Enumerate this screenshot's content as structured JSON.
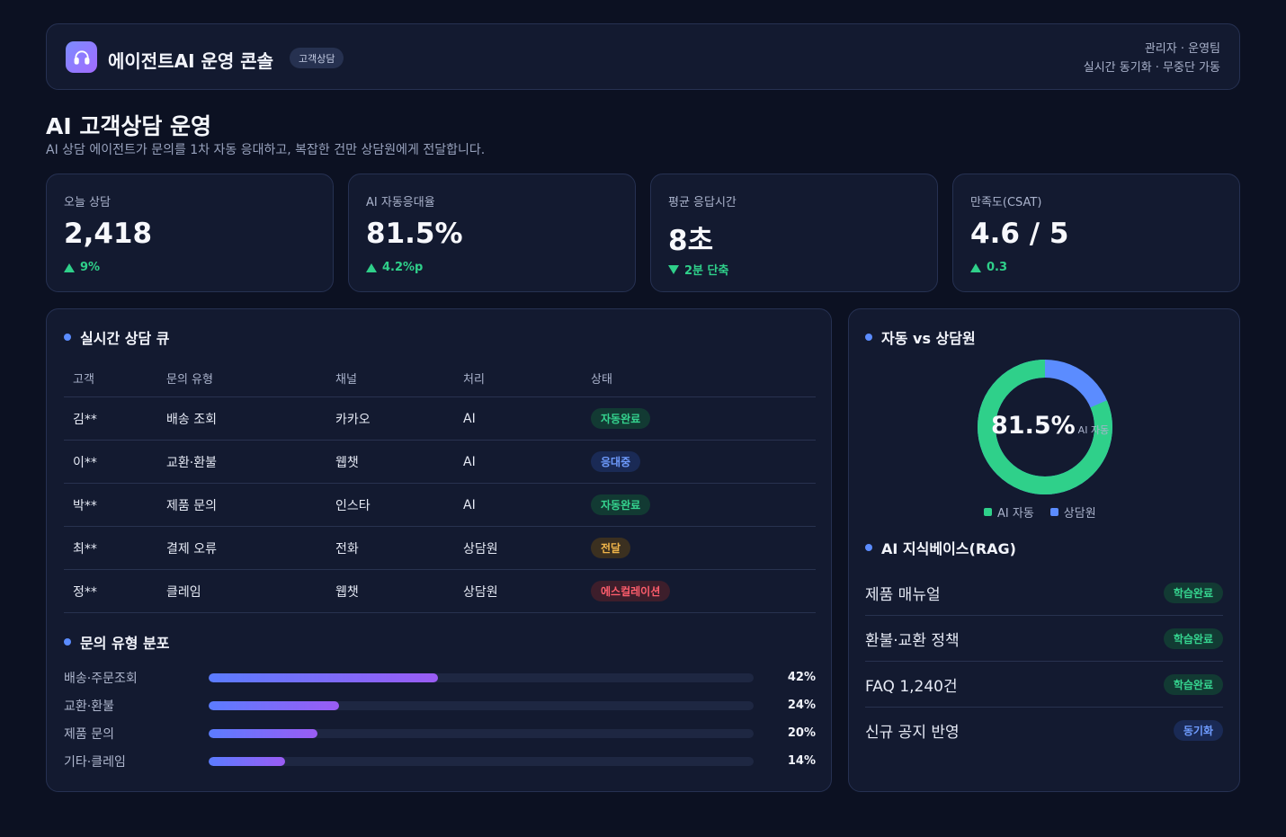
{
  "header": {
    "title": "에이전트AI 운영 콘솔",
    "badge": "고객상담",
    "meta_line1": "관리자 · 운영팀",
    "meta_line2": "실시간 동기화 · 무중단 가동",
    "logo_icon": "headset-icon",
    "accent": "#7b8cff"
  },
  "page": {
    "title": "AI 고객상담 운영",
    "subtitle": "AI 상담 에이전트가 문의를 1차 자동 응대하고, 복잡한 건만 상담원에게 전달합니다."
  },
  "kpis": [
    {
      "label": "오늘 상담",
      "value": "2,418",
      "delta": "9%",
      "direction": "up"
    },
    {
      "label": "AI 자동응대율",
      "value": "81.5%",
      "delta": "4.2%p",
      "direction": "up"
    },
    {
      "label": "평균 응답시간",
      "value": "8초",
      "delta": "2분 단축",
      "direction": "down"
    },
    {
      "label": "만족도(CSAT)",
      "value": "4.6 / 5",
      "delta": "0.3",
      "direction": "up"
    }
  ],
  "queue": {
    "title": "실시간 상담 큐",
    "columns": [
      "고객",
      "문의 유형",
      "채널",
      "처리",
      "상태"
    ],
    "rows": [
      {
        "customer": "김**",
        "type": "배송 조회",
        "channel": "카카오",
        "handler": "AI",
        "status": "자동완료",
        "status_kind": "done"
      },
      {
        "customer": "이**",
        "type": "교환·환불",
        "channel": "웹챗",
        "handler": "AI",
        "status": "응대중",
        "status_kind": "active"
      },
      {
        "customer": "박**",
        "type": "제품 문의",
        "channel": "인스타",
        "handler": "AI",
        "status": "자동완료",
        "status_kind": "done"
      },
      {
        "customer": "최**",
        "type": "결제 오류",
        "channel": "전화",
        "handler": "상담원",
        "status": "전달",
        "status_kind": "handoff"
      },
      {
        "customer": "정**",
        "type": "클레임",
        "channel": "웹챗",
        "handler": "상담원",
        "status": "에스컬레이션",
        "status_kind": "escalation"
      }
    ],
    "status_colors": {
      "done": {
        "fg": "#35d48f",
        "bg": "#123a33"
      },
      "active": {
        "fg": "#6f9cff",
        "bg": "#1a2a55"
      },
      "handoff": {
        "fg": "#f0b54a",
        "bg": "#3b3020"
      },
      "escalation": {
        "fg": "#ff5d6c",
        "bg": "#3d1e2b"
      }
    }
  },
  "distribution": {
    "title": "문의 유형 분포",
    "items": [
      {
        "label": "배송·주문조회",
        "value": 42,
        "display": "42%"
      },
      {
        "label": "교환·환불",
        "value": 24,
        "display": "24%"
      },
      {
        "label": "제품 문의",
        "value": 20,
        "display": "20%"
      },
      {
        "label": "기타·클레임",
        "value": 14,
        "display": "14%"
      }
    ]
  },
  "split": {
    "title": "자동 vs 상담원",
    "center_value": "81.5%",
    "center_caption": "AI 자동",
    "ai_share": 81.5,
    "legend": [
      {
        "label": "AI 자동",
        "color": "#2fd08a"
      },
      {
        "label": "상담원",
        "color": "#5b8cff"
      }
    ]
  },
  "knowledge": {
    "title": "AI 지식베이스(RAG)",
    "items": [
      {
        "name": "제품 매뉴얼",
        "status": "학습완료",
        "kind": "done"
      },
      {
        "name": "환불·교환 정책",
        "status": "학습완료",
        "kind": "done"
      },
      {
        "name": "FAQ 1,240건",
        "status": "학습완료",
        "kind": "done"
      },
      {
        "name": "신규 공지 반영",
        "status": "동기화",
        "kind": "sync"
      }
    ],
    "status_colors": {
      "done": {
        "fg": "#35d48f",
        "bg": "#123a33"
      },
      "sync": {
        "fg": "#6f9cff",
        "bg": "#1a2a55"
      }
    }
  }
}
